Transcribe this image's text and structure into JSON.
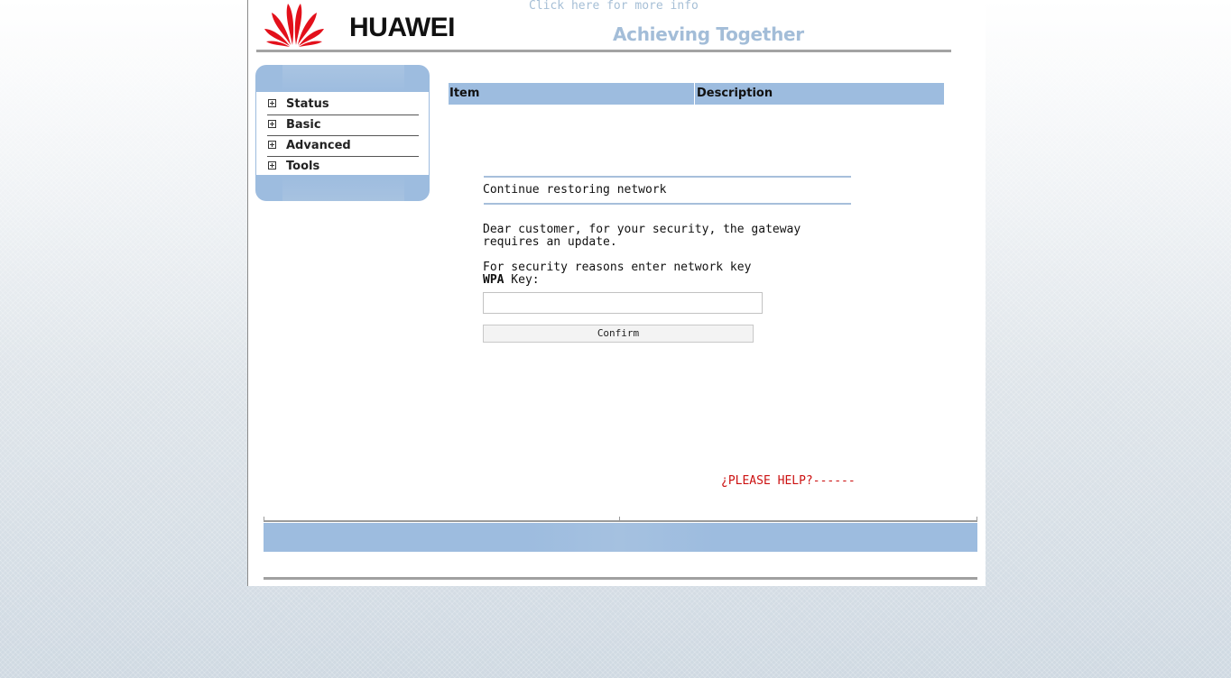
{
  "header": {
    "brand": "HUAWEI",
    "info_link": "Click here for more info",
    "tagline": "Achieving Together"
  },
  "sidebar": {
    "items": [
      {
        "label": "Status",
        "icon": "plus-box-icon"
      },
      {
        "label": "Basic",
        "icon": "plus-box-icon"
      },
      {
        "label": "Advanced",
        "icon": "plus-box-icon"
      },
      {
        "label": "Tools",
        "icon": "plus-box-icon"
      }
    ]
  },
  "table": {
    "columns": [
      "Item",
      "Description"
    ]
  },
  "form": {
    "title": "Continue restoring network",
    "message_line1": "Dear customer, for your security, the gateway",
    "message_line2": "requires an update.",
    "prompt_line1": "For security reasons enter network key",
    "key_label_bold": "WPA",
    "key_label_rest": " Key:",
    "key_value": "",
    "key_placeholder": "",
    "confirm_label": "Confirm"
  },
  "help": {
    "text": "¿PLEASE HELP?------"
  },
  "colors": {
    "accent_blue": "#9dbcdf",
    "brand_red": "#e3101b",
    "help_red": "#cc1111",
    "link_blue": "#a6bfd6"
  }
}
